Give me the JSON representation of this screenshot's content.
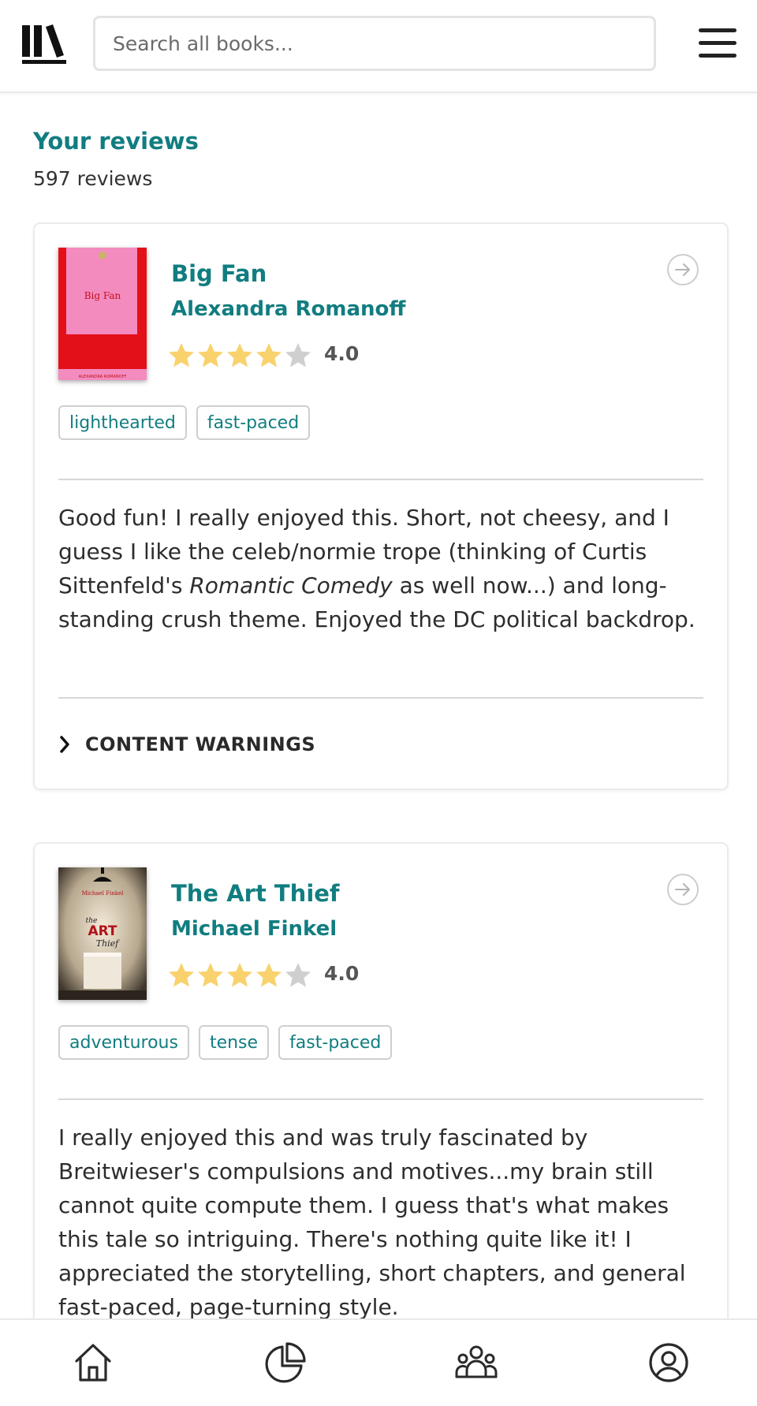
{
  "search": {
    "placeholder": "Search all books..."
  },
  "page": {
    "title": "Your reviews",
    "count": "597 reviews"
  },
  "reviews": [
    {
      "title": "Big Fan",
      "author": "Alexandra Romanoff",
      "stars": 4,
      "rating": "4.0",
      "tags": [
        "lighthearted",
        "fast-paced"
      ],
      "text_before": "Good fun! I really enjoyed this. Short, not cheesy, and I guess I like the celeb/normie trope (thinking of Curtis Sittenfeld's ",
      "text_em": "Romantic Comedy",
      "text_after": " as well now...) and long-standing crush theme. Enjoyed the DC political backdrop.",
      "content_warnings_label": "CONTENT WARNINGS",
      "cover": {
        "title": "Big Fan",
        "author": "ALEXANDRA ROMANOFF",
        "bg": "#f48bbf",
        "accent": "#e3101a"
      }
    },
    {
      "title": "The Art Thief",
      "author": "Michael Finkel",
      "stars": 4,
      "rating": "4.0",
      "tags": [
        "adventurous",
        "tense",
        "fast-paced"
      ],
      "text": "I really enjoyed this and was truly fascinated by Breitwieser's compulsions and motives...my brain still cannot quite compute them. I guess that's what makes this tale so intriguing. There's nothing quite like it! I appreciated the storytelling, short chapters, and general fast-paced, page-turning style.",
      "cover": {
        "author": "Michael Finkel",
        "the": "the",
        "art": "ART",
        "thief": "Thief",
        "accent": "#b0121a"
      }
    }
  ],
  "nav": [
    "home-icon",
    "stats-icon",
    "community-icon",
    "profile-icon"
  ],
  "colors": {
    "accent": "#117d80",
    "star": "#f9d26e",
    "star_empty": "#cfcfcf"
  }
}
